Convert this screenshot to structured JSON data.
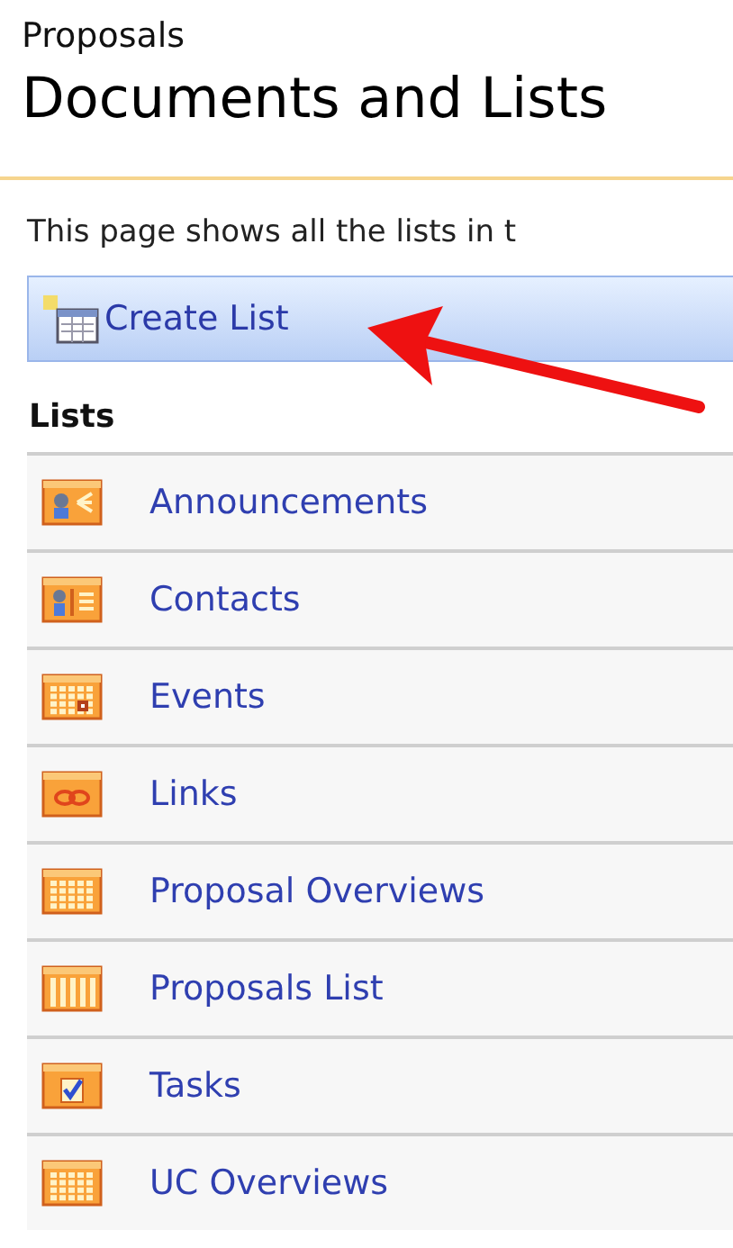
{
  "breadcrumb": "Proposals",
  "title": "Documents and Lists",
  "description": "This page shows all the lists in t",
  "toolbar": {
    "create_button": "Create List"
  },
  "section_heading": "Lists",
  "lists": [
    {
      "label": "Announcements",
      "kind": "announcement"
    },
    {
      "label": "Contacts",
      "kind": "contact"
    },
    {
      "label": "Events",
      "kind": "calendar"
    },
    {
      "label": "Links",
      "kind": "link"
    },
    {
      "label": "Proposal Overviews",
      "kind": "grid"
    },
    {
      "label": "Proposals List",
      "kind": "columns"
    },
    {
      "label": "Tasks",
      "kind": "task"
    },
    {
      "label": "UC Overviews",
      "kind": "grid"
    }
  ]
}
